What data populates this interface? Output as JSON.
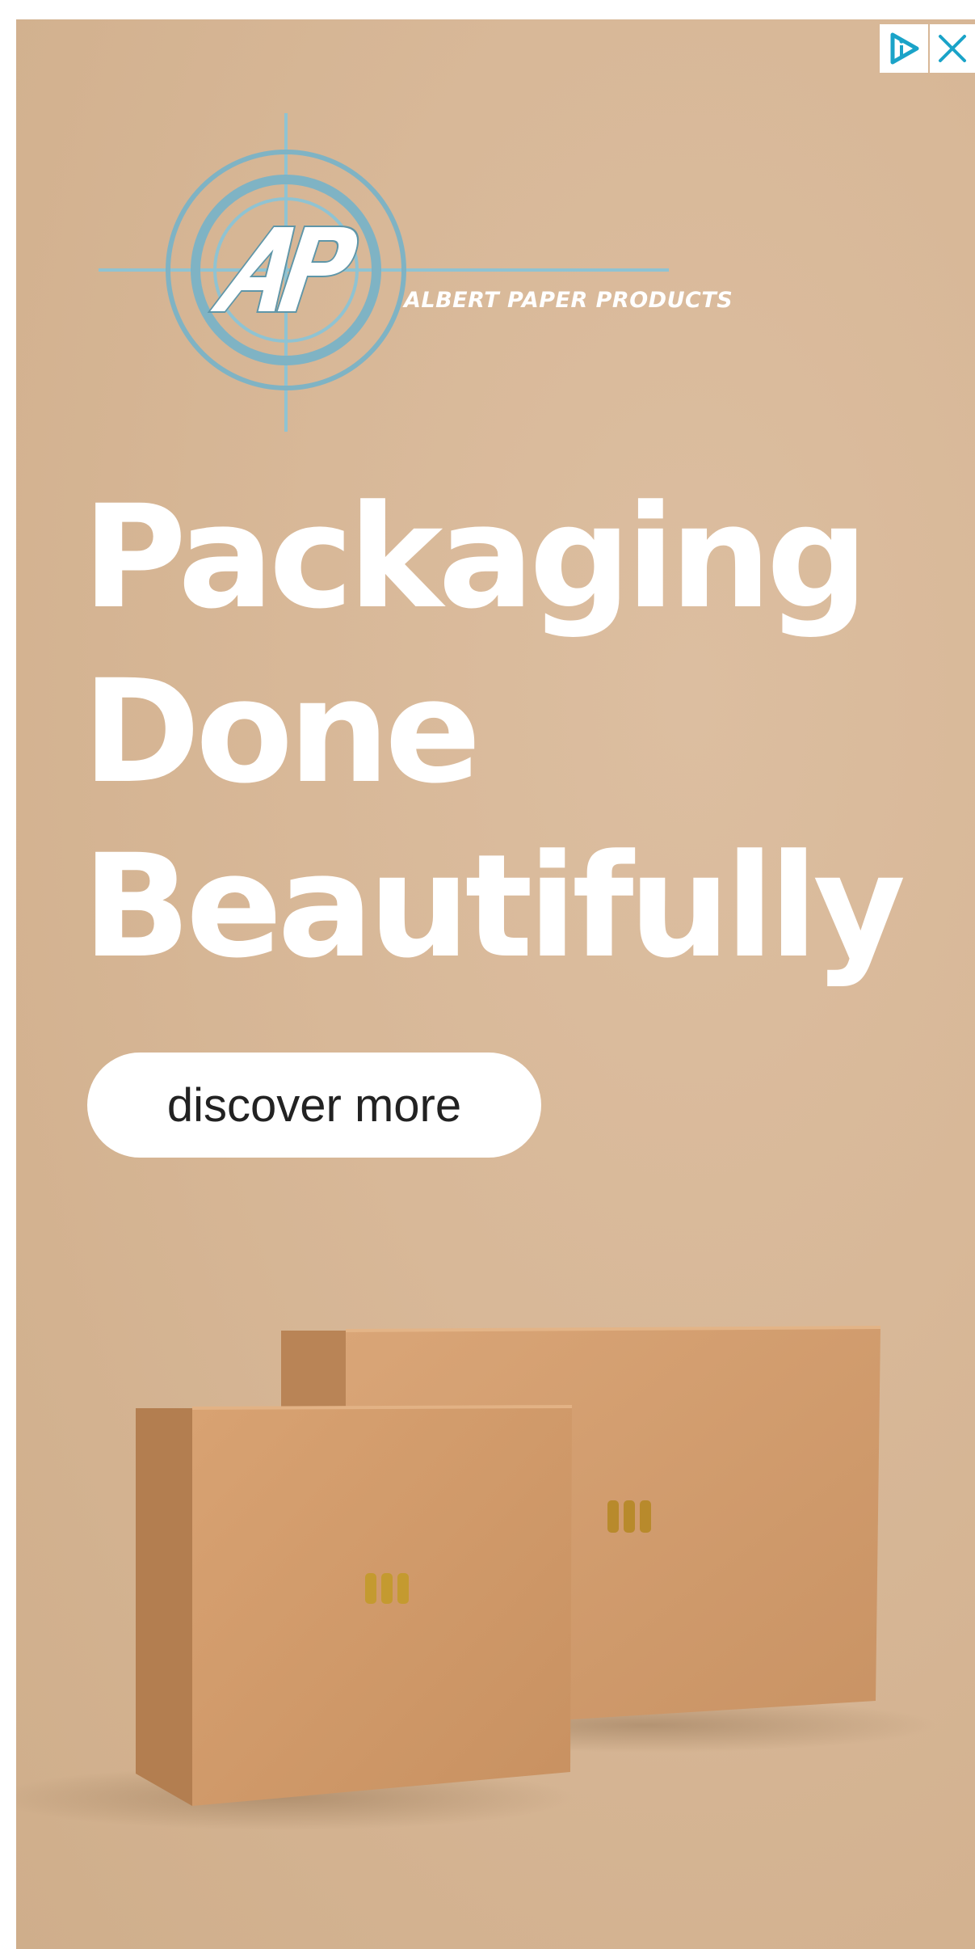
{
  "ad": {
    "brand": {
      "initials": "AP",
      "name": "ALBERT PAPER PRODUCTS"
    },
    "headline": [
      "Packaging",
      "Done",
      "Beautifully"
    ],
    "cta_label": "discover more",
    "adchoices_icon": "adchoices-icon",
    "close_icon": "close-icon",
    "colors": {
      "background": "#d8b898",
      "accent": "#1aa3c8",
      "logo_ring": "#7fb3c4",
      "box": "#cf9c6e"
    }
  }
}
